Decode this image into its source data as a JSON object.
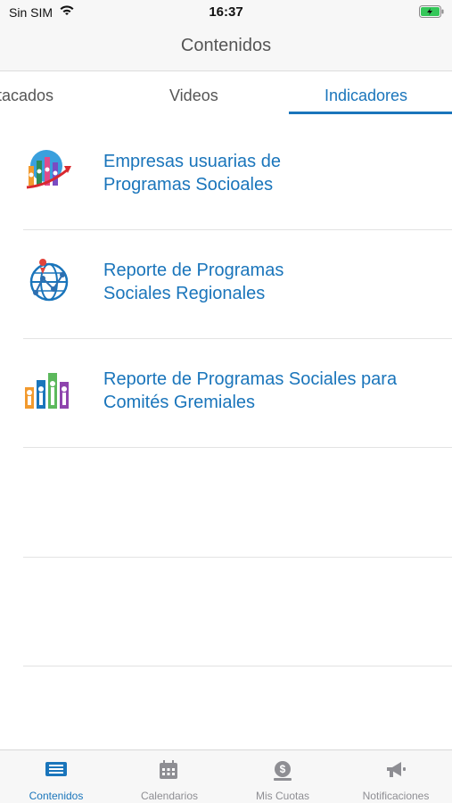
{
  "status_bar": {
    "carrier": "Sin SIM",
    "time": "16:37"
  },
  "nav": {
    "title": "Contenidos"
  },
  "tabs": [
    {
      "label": "stacados"
    },
    {
      "label": "Videos"
    },
    {
      "label": "Indicadores",
      "active": true
    }
  ],
  "list": [
    {
      "title_line1": "Empresas usuarias de",
      "title_line2": "Programas Socioales",
      "icon": "chart-people-icon"
    },
    {
      "title_line1": "Reporte de Programas",
      "title_line2": "Sociales Regionales",
      "icon": "globe-network-icon"
    },
    {
      "title_line1": "Reporte de Programas Sociales para",
      "title_line2": "Comités Gremiales",
      "icon": "bar-people-icon"
    }
  ],
  "tab_bar": [
    {
      "label": "Contenidos",
      "icon": "news-icon",
      "active": true
    },
    {
      "label": "Calendarios",
      "icon": "calendar-icon"
    },
    {
      "label": "Mis Cuotas",
      "icon": "money-icon"
    },
    {
      "label": "Notificaciones",
      "icon": "megaphone-icon"
    }
  ],
  "colors": {
    "accent": "#1a75bb",
    "inactive": "#8e8e93",
    "bar_bg": "#f7f7f7"
  }
}
